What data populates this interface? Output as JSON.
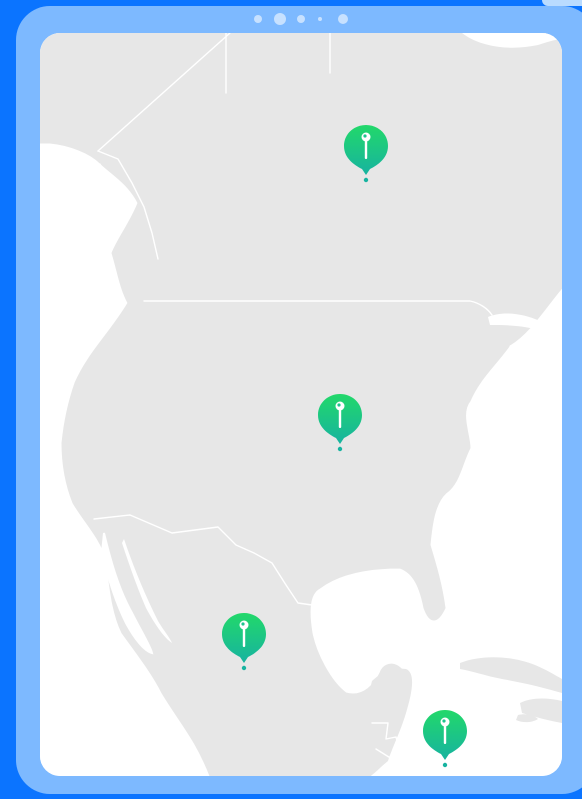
{
  "map": {
    "region": "north-america",
    "land_color": "#e7e7e7",
    "water_color": "#ffffff",
    "border_color": "#ffffff"
  },
  "pagination": {
    "dots": 5,
    "active_index": 1
  },
  "pins": [
    {
      "id": "pin-canada",
      "icon": "map-pin-icon",
      "color_top": "#1fd17a",
      "color_bottom": "#17b89c"
    },
    {
      "id": "pin-usa",
      "icon": "map-pin-icon",
      "color_top": "#1fd17a",
      "color_bottom": "#17b89c"
    },
    {
      "id": "pin-mexico",
      "icon": "map-pin-icon",
      "color_top": "#1fd17a",
      "color_bottom": "#17b89c"
    },
    {
      "id": "pin-central-america",
      "icon": "map-pin-icon",
      "color_top": "#1fd17a",
      "color_bottom": "#17b89c"
    }
  ],
  "theme": {
    "background": "#0b74ff",
    "device_frame": "#7db9ff",
    "screen": "#ffffff"
  }
}
